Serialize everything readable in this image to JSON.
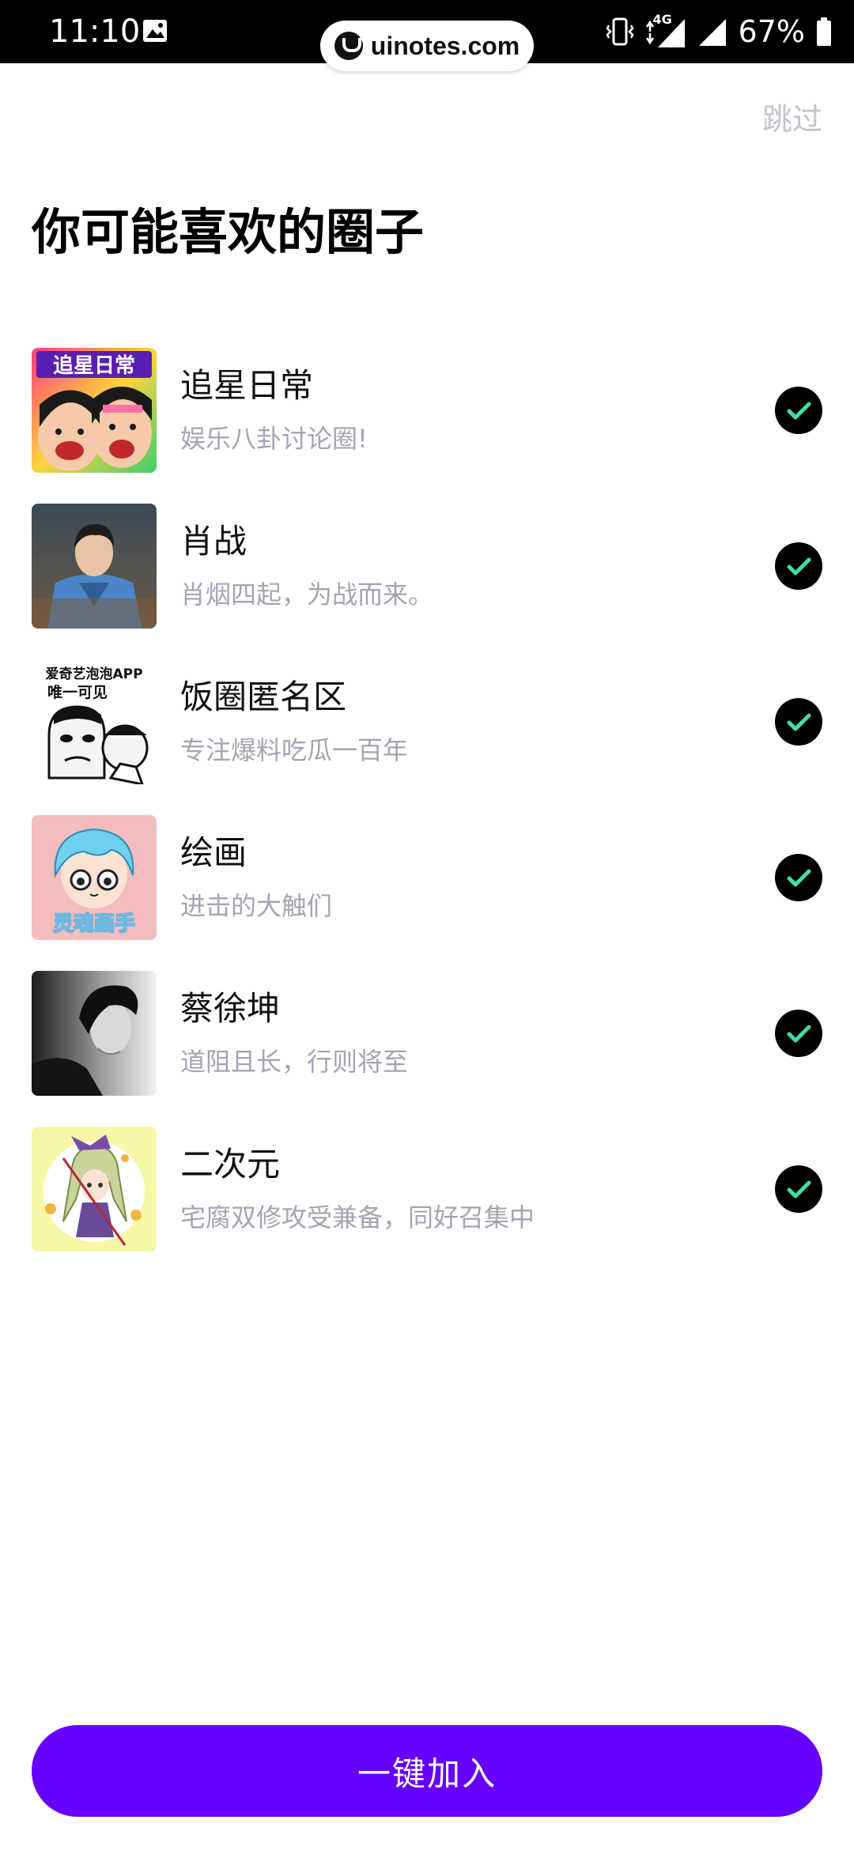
{
  "status_bar": {
    "time": "11:10",
    "network": "4G",
    "battery": "67%"
  },
  "watermark": {
    "text": "uinotes.com"
  },
  "header": {
    "skip_label": "跳过",
    "title": "你可能喜欢的圈子"
  },
  "circles": [
    {
      "name": "追星日常",
      "description": "娱乐八卦讨论圈!",
      "selected": true,
      "avatar_text": "追星日常"
    },
    {
      "name": "肖战",
      "description": "肖烟四起，为战而来。",
      "selected": true
    },
    {
      "name": "饭圈匿名区",
      "description": "专注爆料吃瓜一百年",
      "selected": true,
      "avatar_text_line1": "爱奇艺泡泡APP",
      "avatar_text_line2": "唯一可见"
    },
    {
      "name": "绘画",
      "description": "进击的大触们",
      "selected": true,
      "avatar_text": "灵魂画手"
    },
    {
      "name": "蔡徐坤",
      "description": "道阻且长，行则将至",
      "selected": true
    },
    {
      "name": "二次元",
      "description": "宅腐双修攻受兼备，同好召集中",
      "selected": true
    }
  ],
  "footer": {
    "join_all_label": "一键加入"
  },
  "colors": {
    "accent": "#6600ff",
    "check_mark": "#3fe0a0",
    "secondary_text": "#a4a4b4",
    "skip_text": "#c3c3cc"
  }
}
